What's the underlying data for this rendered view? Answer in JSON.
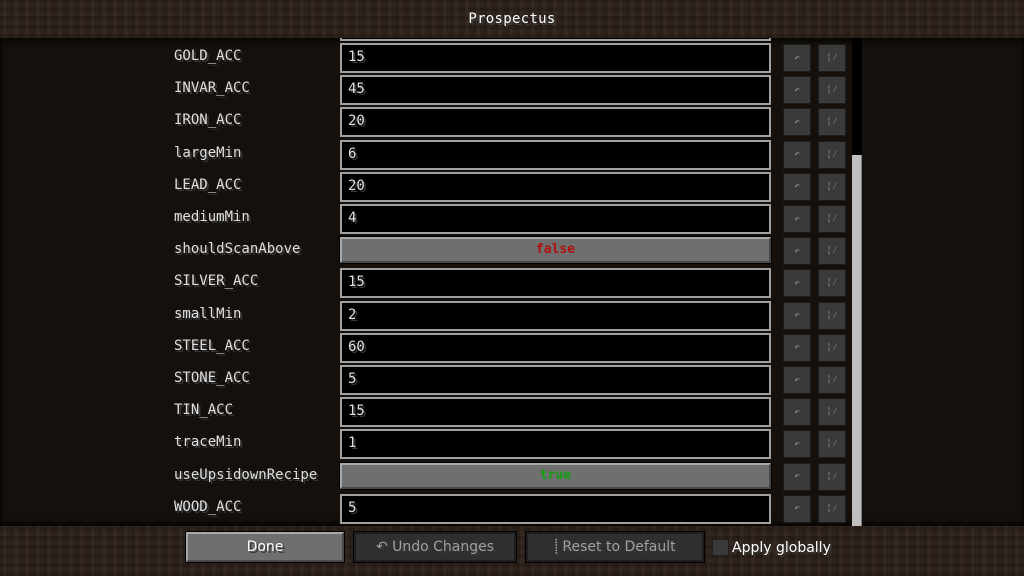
{
  "title": "Prospectus",
  "entries": [
    {
      "name": "GOLD_ACC",
      "type": "number",
      "value": "15"
    },
    {
      "name": "INVAR_ACC",
      "type": "number",
      "value": "45"
    },
    {
      "name": "IRON_ACC",
      "type": "number",
      "value": "20"
    },
    {
      "name": "largeMin",
      "type": "number",
      "value": "6"
    },
    {
      "name": "LEAD_ACC",
      "type": "number",
      "value": "20"
    },
    {
      "name": "mediumMin",
      "type": "number",
      "value": "4"
    },
    {
      "name": "shouldScanAbove",
      "type": "boolean",
      "value": "false"
    },
    {
      "name": "SILVER_ACC",
      "type": "number",
      "value": "15"
    },
    {
      "name": "smallMin",
      "type": "number",
      "value": "2"
    },
    {
      "name": "STEEL_ACC",
      "type": "number",
      "value": "60"
    },
    {
      "name": "STONE_ACC",
      "type": "number",
      "value": "5"
    },
    {
      "name": "TIN_ACC",
      "type": "number",
      "value": "15"
    },
    {
      "name": "traceMin",
      "type": "number",
      "value": "1"
    },
    {
      "name": "useUpsidownRecipe",
      "type": "boolean",
      "value": "true"
    },
    {
      "name": "WOOD_ACC",
      "type": "number",
      "value": "5"
    }
  ],
  "row_icons": {
    "undo": "undo-arrow-icon",
    "reset": "reset-default-icon"
  },
  "colors": {
    "false": "#b01010",
    "true": "#10a010"
  },
  "scrollbar": {
    "position_fraction": 1.0,
    "visible_fraction": 0.76
  },
  "footer": {
    "done_label": "Done",
    "undo_label": "↶ Undo Changes",
    "reset_label": "⸽ Reset to Default",
    "apply_globally_label": "Apply globally",
    "apply_globally_checked": false
  }
}
